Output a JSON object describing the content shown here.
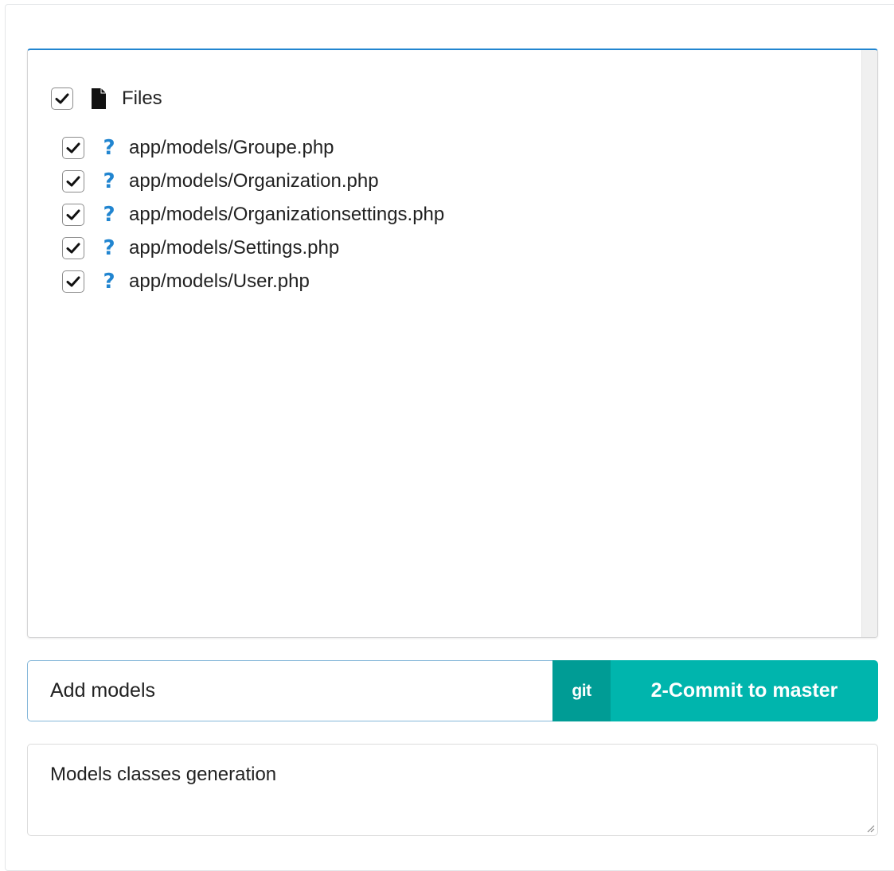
{
  "files_panel": {
    "root": {
      "label": "Files",
      "checked": true,
      "icon": "file-icon"
    },
    "items": [
      {
        "path": "app/models/Groupe.php",
        "checked": true,
        "status_icon": "question-icon"
      },
      {
        "path": "app/models/Organization.php",
        "checked": true,
        "status_icon": "question-icon"
      },
      {
        "path": "app/models/Organizationsettings.php",
        "checked": true,
        "status_icon": "question-icon"
      },
      {
        "path": "app/models/Settings.php",
        "checked": true,
        "status_icon": "question-icon"
      },
      {
        "path": "app/models/User.php",
        "checked": true,
        "status_icon": "question-icon"
      }
    ],
    "status_symbol": "?",
    "accent_color": "#2185d0"
  },
  "commit": {
    "message_value": "Add models",
    "git_label": "git",
    "button_label": "2-Commit to master",
    "button_color": "#00b5ad"
  },
  "description": {
    "value": "Models classes generation"
  }
}
